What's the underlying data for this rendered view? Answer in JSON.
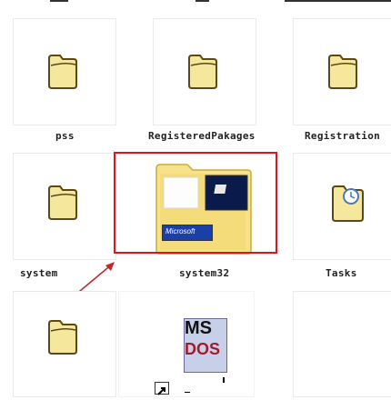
{
  "folders": [
    {
      "label": "pss"
    },
    {
      "label": "RegisteredPakages"
    },
    {
      "label": "Registration"
    },
    {
      "label": "system"
    },
    {
      "label": "system32"
    },
    {
      "label": "Tasks"
    }
  ],
  "system32_card_text": "Microsoft",
  "ms_dos_text_line1": "MS",
  "ms_dos_text_line2": "DOS",
  "colors": {
    "highlight": "#e0151c",
    "folder_fill": "#f5e79c",
    "folder_stroke": "#5b4a18",
    "arrow": "#c7262a"
  }
}
